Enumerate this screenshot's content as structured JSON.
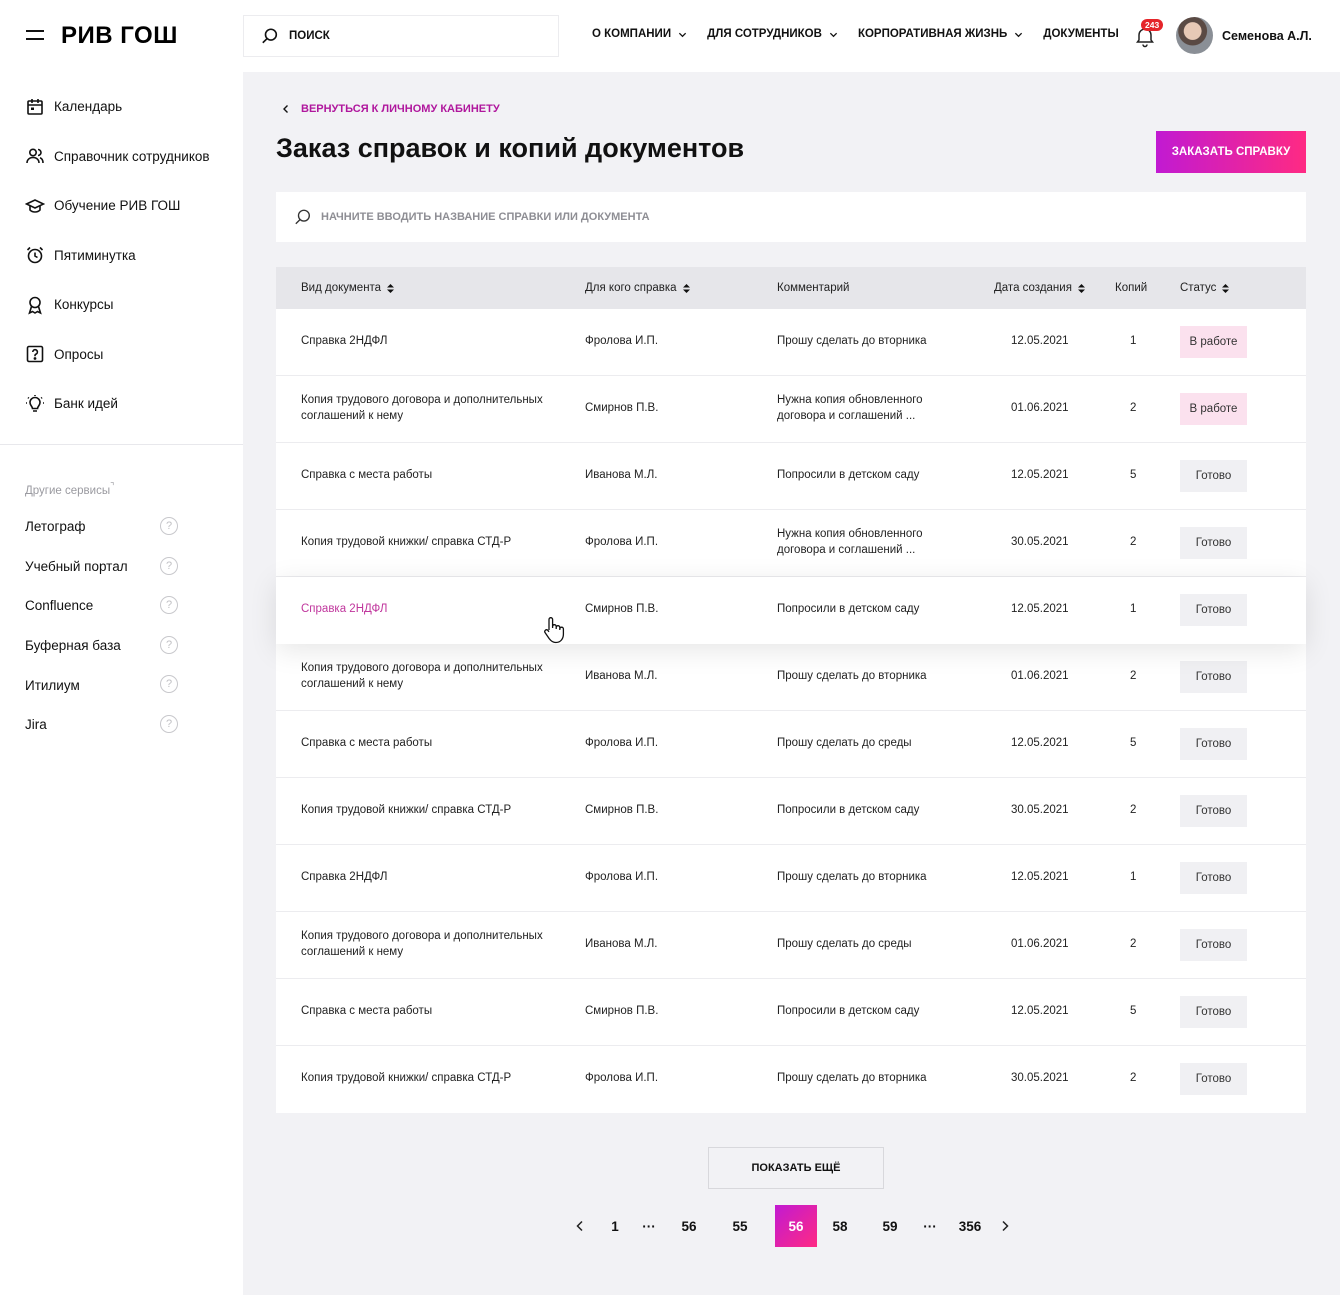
{
  "brand": {
    "logo": "РИВ ГОШ",
    "accent": "#d41fbe"
  },
  "sidebar": {
    "items": [
      {
        "label": "Календарь",
        "icon": "calendar-icon"
      },
      {
        "label": "Справочник сотрудников",
        "icon": "people-icon"
      },
      {
        "label": "Обучение РИВ ГОШ",
        "icon": "graduation-cap-icon"
      },
      {
        "label": "Пятиминутка",
        "icon": "alarm-clock-icon"
      },
      {
        "label": "Конкурсы",
        "icon": "award-ribbon-icon"
      },
      {
        "label": "Опросы",
        "icon": "question-square-icon"
      },
      {
        "label": "Банк идей",
        "icon": "lightbulb-icon"
      }
    ],
    "other_title": "Другие сервисы",
    "services": [
      {
        "label": "Летограф"
      },
      {
        "label": "Учебный портал"
      },
      {
        "label": "Confluence"
      },
      {
        "label": "Буферная база"
      },
      {
        "label": "Итилиум"
      },
      {
        "label": "Jira"
      }
    ],
    "help_glyph": "?"
  },
  "topbar": {
    "search_label": "ПОИСК",
    "nav": [
      {
        "label": "О КОМПАНИИ",
        "has_dropdown": true
      },
      {
        "label": "ДЛЯ СОТРУДНИКОВ",
        "has_dropdown": true
      },
      {
        "label": "КОРПОРАТИВНАЯ ЖИЗНЬ",
        "has_dropdown": true
      },
      {
        "label": "ДОКУМЕНТЫ",
        "has_dropdown": false
      }
    ],
    "notifications": "243",
    "username": "Семенова А.Л."
  },
  "page": {
    "back_label": "ВЕРНУТЬСЯ К ЛИЧНОМУ КАБИНЕТУ",
    "title": "Заказ справок и копий документов",
    "order_button": "ЗАКАЗАТЬ СПРАВКУ",
    "filter_placeholder": "НАЧНИТЕ ВВОДИТЬ НАЗВАНИЕ СПРАВКИ ИЛИ ДОКУМЕНТА"
  },
  "table": {
    "columns": [
      "Вид документа",
      "Для кого справка",
      "Комментарий",
      "Дата создания",
      "Копий",
      "Статус"
    ],
    "rows": [
      {
        "doc": "Справка 2НДФЛ",
        "for": "Фролова И.П.",
        "comment": "Прошу сделать до вторника",
        "date": "12.05.2021",
        "copies": "1",
        "status": "В работе",
        "status_type": "work"
      },
      {
        "doc": "Копия трудового договора и дополнительных соглашений к нему",
        "for": "Смирнов П.В.",
        "comment": "Нужна копия обновленного договора и соглашений ...",
        "date": "01.06.2021",
        "copies": "2",
        "status": "В работе",
        "status_type": "work"
      },
      {
        "doc": "Справка с места работы",
        "for": "Иванова М.Л.",
        "comment": "Попросили в детском саду",
        "date": "12.05.2021",
        "copies": "5",
        "status": "Готово",
        "status_type": "done"
      },
      {
        "doc": "Копия трудовой книжки/ справка СТД-Р",
        "for": "Фролова И.П.",
        "comment": "Нужна копия обновленного договора и соглашений ...",
        "date": "30.05.2021",
        "copies": "2",
        "status": "Готово",
        "status_type": "done"
      },
      {
        "doc": "Справка 2НДФЛ",
        "for": "Смирнов П.В.",
        "comment": "Попросили в детском саду",
        "date": "12.05.2021",
        "copies": "1",
        "status": "Готово",
        "status_type": "done",
        "hover": true
      },
      {
        "doc": "Копия трудового договора и дополнительных соглашений к нему",
        "for": "Иванова М.Л.",
        "comment": "Прошу сделать до вторника",
        "date": "01.06.2021",
        "copies": "2",
        "status": "Готово",
        "status_type": "done"
      },
      {
        "doc": "Справка с места работы",
        "for": "Фролова И.П.",
        "comment": "Прошу сделать до среды",
        "date": "12.05.2021",
        "copies": "5",
        "status": "Готово",
        "status_type": "done"
      },
      {
        "doc": "Копия трудовой книжки/ справка СТД-Р",
        "for": "Смирнов П.В.",
        "comment": "Попросили в детском саду",
        "date": "30.05.2021",
        "copies": "2",
        "status": "Готово",
        "status_type": "done"
      },
      {
        "doc": "Справка 2НДФЛ",
        "for": "Фролова И.П.",
        "comment": "Прошу сделать до вторника",
        "date": "12.05.2021",
        "copies": "1",
        "status": "Готово",
        "status_type": "done"
      },
      {
        "doc": "Копия трудового договора и дополнительных соглашений к нему",
        "for": "Иванова М.Л.",
        "comment": "Прошу сделать до среды",
        "date": "01.06.2021",
        "copies": "2",
        "status": "Готово",
        "status_type": "done"
      },
      {
        "doc": "Справка с места работы",
        "for": "Смирнов П.В.",
        "comment": "Попросили в детском саду",
        "date": "12.05.2021",
        "copies": "5",
        "status": "Готово",
        "status_type": "done"
      },
      {
        "doc": "Копия трудовой книжки/ справка СТД-Р",
        "for": "Фролова И.П.",
        "comment": "Прошу сделать до вторника",
        "date": "30.05.2021",
        "copies": "2",
        "status": "Готово",
        "status_type": "done"
      }
    ]
  },
  "pagination": {
    "show_more": "ПОКАЗАТЬ ЕЩЁ",
    "pages": [
      "1",
      "···",
      "56",
      "55",
      "56",
      "58",
      "59",
      "···",
      "356"
    ],
    "current": "56"
  }
}
